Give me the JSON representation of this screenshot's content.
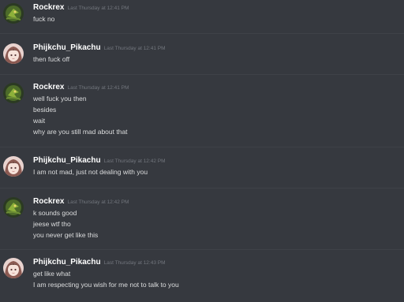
{
  "messages": [
    {
      "author": "Rockrex",
      "timestamp": "Last Thursday at 12:41 PM",
      "avatar_icon": "green-bird-avatar-icon",
      "lines": [
        "fuck no"
      ]
    },
    {
      "author": "Phijkchu_Pikachu",
      "timestamp": "Last Thursday at 12:41 PM",
      "avatar_icon": "anime-girl-avatar-icon",
      "lines": [
        "then fuck off"
      ]
    },
    {
      "author": "Rockrex",
      "timestamp": "Last Thursday at 12:41 PM",
      "avatar_icon": "green-bird-avatar-icon",
      "lines": [
        "well fuck you then",
        "besides",
        "wait",
        "why are you still mad about that"
      ]
    },
    {
      "author": "Phijkchu_Pikachu",
      "timestamp": "Last Thursday at 12:42 PM",
      "avatar_icon": "anime-girl-avatar-icon",
      "lines": [
        "I am not mad, just not dealing with you"
      ]
    },
    {
      "author": "Rockrex",
      "timestamp": "Last Thursday at 12:42 PM",
      "avatar_icon": "green-bird-avatar-icon",
      "lines": [
        "k sounds good",
        "jeese wtf tho",
        "you never get like this"
      ]
    },
    {
      "author": "Phijkchu_Pikachu",
      "timestamp": "Last Thursday at 12:43 PM",
      "avatar_icon": "anime-girl-avatar-icon",
      "lines": [
        "get like what",
        "I am respecting you wish for me not to talk to you"
      ]
    }
  ],
  "colors": {
    "background": "#36393f",
    "author": "#ffffff",
    "timestamp": "#72767d",
    "text": "#dcddde"
  }
}
